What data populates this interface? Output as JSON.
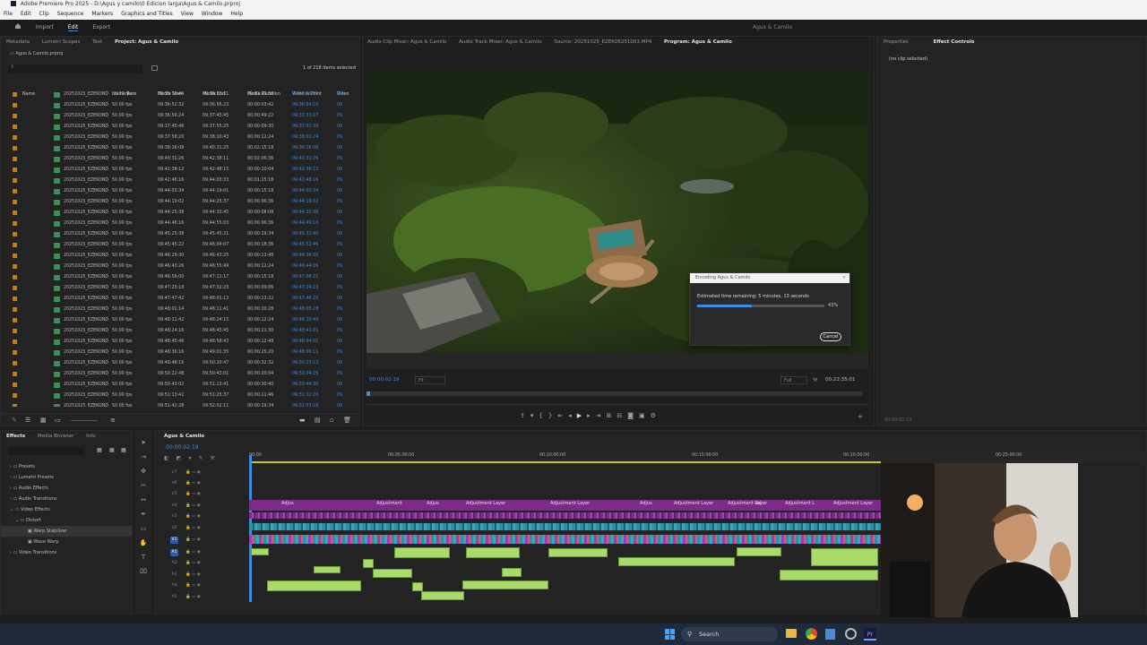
{
  "window": {
    "title": "Adobe Premiere Pro 2025 - D:\\Agus y camilo\\0 Edicion larga\\Agus & Camilo.prproj"
  },
  "menu": [
    "File",
    "Edit",
    "Clip",
    "Sequence",
    "Markers",
    "Graphics and Titles",
    "View",
    "Window",
    "Help"
  ],
  "workspace": {
    "tabs": [
      "Import",
      "Edit",
      "Export"
    ],
    "active": "Edit",
    "sequence_title": "Agus & Camilo"
  },
  "left_panel": {
    "tabs": [
      "Metadata",
      "Lumetri Scopes",
      "Text",
      "Project: Agus & Camilo"
    ],
    "project_file": "Agus & Camilo.prproj",
    "search_placeholder": "",
    "selection_info": "1 of 218 items selected",
    "columns": [
      "Name",
      "Frame Rate",
      "Media Start",
      "Media End",
      "Media Duration",
      "Video In Point",
      "Video"
    ],
    "rows": [
      [
        "20251025_EZEKOND",
        "50.00 fps",
        "09:35:10:44",
        "09:36:52:31",
        "00:01:43:38",
        "09:36:32:29",
        "09"
      ],
      [
        "20251025_EZEKOND",
        "50.00 fps",
        "09:36:52:32",
        "09:36:56:23",
        "00:00:03:42",
        "09:36:54:10",
        "09"
      ],
      [
        "20251025_EZEKOND",
        "50.00 fps",
        "09:36:56:24",
        "09:37:45:45",
        "00:00:49:22",
        "09:37:33:07",
        "09"
      ],
      [
        "20251025_EZEKOND",
        "50.00 fps",
        "09:37:45:46",
        "09:37:55:25",
        "00:00:09:30",
        "09:37:51:39",
        "09"
      ],
      [
        "20251025_EZEKOND",
        "50.00 fps",
        "09:37:58:20",
        "09:38:10:43",
        "00:00:12:24",
        "09:38:01:24",
        "09"
      ],
      [
        "20251025_EZEKOND",
        "50.00 fps",
        "09:38:16:08",
        "09:40:31:25",
        "00:02:15:18",
        "09:38:16:08",
        "09"
      ],
      [
        "20251025_EZEKOND",
        "50.00 fps",
        "09:40:31:26",
        "09:42:38:11",
        "00:02:06:36",
        "09:40:31:26",
        "09"
      ],
      [
        "20251025_EZEKOND",
        "50.00 fps",
        "09:42:38:12",
        "09:42:48:15",
        "00:00:10:04",
        "09:42:38:12",
        "09"
      ],
      [
        "20251025_EZEKOND",
        "50.00 fps",
        "09:42:48:16",
        "09:44:03:33",
        "00:01:15:18",
        "09:42:48:16",
        "09"
      ],
      [
        "20251025_EZEKOND",
        "50.00 fps",
        "09:44:03:34",
        "09:44:19:01",
        "00:00:15:18",
        "09:44:03:34",
        "09"
      ],
      [
        "20251025_EZEKOND",
        "50.00 fps",
        "09:44:19:02",
        "09:44:25:37",
        "00:00:06:36",
        "09:44:19:02",
        "09"
      ],
      [
        "20251025_EZEKOND",
        "50.00 fps",
        "09:44:25:38",
        "09:44:33:45",
        "00:00:08:08",
        "09:44:25:38",
        "09"
      ],
      [
        "20251025_EZEKOND",
        "50.00 fps",
        "09:44:48:16",
        "09:44:55:03",
        "00:00:06:36",
        "09:44:49:10",
        "09"
      ],
      [
        "20251025_EZEKOND",
        "50.00 fps",
        "09:45:25:38",
        "09:45:45:21",
        "00:00:19:34",
        "09:45:31:46",
        "09"
      ],
      [
        "20251025_EZEKOND",
        "50.00 fps",
        "09:45:45:22",
        "09:46:04:07",
        "00:00:18:36",
        "09:45:52:46",
        "09"
      ],
      [
        "20251025_EZEKOND",
        "50.00 fps",
        "09:46:29:30",
        "09:46:43:25",
        "00:00:13:46",
        "09:46:36:35",
        "09"
      ],
      [
        "20251025_EZEKOND",
        "50.00 fps",
        "09:46:43:26",
        "09:46:55:49",
        "00:00:12:24",
        "09:46:44:06",
        "09"
      ],
      [
        "20251025_EZEKOND",
        "50.00 fps",
        "09:46:56:00",
        "09:47:11:17",
        "00:00:15:18",
        "09:47:08:21",
        "09"
      ],
      [
        "20251025_EZEKOND",
        "50.00 fps",
        "09:47:23:18",
        "09:47:32:23",
        "00:00:09:06",
        "09:47:24:23",
        "09"
      ],
      [
        "20251025_EZEKOND",
        "50.00 fps",
        "09:47:47:42",
        "09:48:01:13",
        "00:00:13:22",
        "09:47:48:25",
        "09"
      ],
      [
        "20251025_EZEKOND",
        "50.00 fps",
        "09:48:01:14",
        "09:48:11:41",
        "00:00:10:28",
        "09:48:05:28",
        "09"
      ],
      [
        "20251025_EZEKOND",
        "50.00 fps",
        "09:48:11:42",
        "09:48:24:15",
        "00:00:12:24",
        "09:48:19:49",
        "09"
      ],
      [
        "20251025_EZEKOND",
        "50.00 fps",
        "09:48:24:16",
        "09:48:45:45",
        "00:00:21:30",
        "09:48:41:01",
        "09"
      ],
      [
        "20251025_EZEKOND",
        "50.00 fps",
        "09:48:45:46",
        "09:48:58:43",
        "00:00:12:48",
        "09:48:54:01",
        "09"
      ],
      [
        "20251025_EZEKOND",
        "50.00 fps",
        "09:48:36:16",
        "09:49:01:35",
        "00:00:25:20",
        "09:48:56:11",
        "09"
      ],
      [
        "20251025_EZEKOND",
        "50.00 fps",
        "09:49:48:16",
        "09:50:20:47",
        "00:00:32:32",
        "09:50:13:13",
        "09"
      ],
      [
        "20251025_EZEKOND",
        "50.00 fps",
        "09:50:22:48",
        "09:50:43:01",
        "00:00:20:04",
        "09:50:34:25",
        "09"
      ],
      [
        "20251025_EZEKOND",
        "50.00 fps",
        "09:50:43:02",
        "09:51:13:41",
        "00:00:30:40",
        "09:50:44:30",
        "09"
      ],
      [
        "20251025_EZEKOND",
        "50.00 fps",
        "09:51:13:42",
        "09:51:25:37",
        "00:00:11:46",
        "09:51:12:20",
        "09"
      ],
      [
        "20251025_EZEKOND",
        "50.00 fps",
        "09:51:42:28",
        "09:52:02:11",
        "00:00:19:34",
        "09:51:53:18",
        "09"
      ]
    ]
  },
  "monitor": {
    "source_tabs": [
      "Audio Clip Mixer: Agus & Camilo",
      "Audio Track Mixer: Agus & Camilo",
      "Source: 20251025_EZEK06251003.MP4",
      "Program: Agus & Camilo"
    ],
    "timecode_current": "00:00:02:19",
    "fit": "Fit",
    "quality": "Full",
    "timecode_total": "00:22:35:01"
  },
  "encoding_dialog": {
    "title": "Encoding Agus & Camilo",
    "message": "Estimated time remaining: 5 minutes, 13 seconds",
    "progress": 0.43,
    "progress_label": "43%",
    "cancel_label": "Cancel"
  },
  "right_panel": {
    "tabs": [
      "Properties",
      "Effect Controls"
    ],
    "no_clip": "(no clip selected)",
    "footer_timecode": "00:00:02:19"
  },
  "effects_panel": {
    "tabs": [
      "Effects",
      "Media Browser",
      "Info"
    ],
    "tree": [
      "Presets",
      "Lumetri Presets",
      "Audio Effects",
      "Audio Transitions",
      "Video Effects",
      "Distort",
      "Warp Stabilizer",
      "Wave Warp",
      "Video Transitions"
    ]
  },
  "timeline": {
    "sequence_tab": "Agus & Camilo",
    "timecode": "00:00:02:19",
    "ruler": [
      "00:00",
      "00:05:00:00",
      "00:10:00:00",
      "00:15:00:00",
      "00:20:00:00",
      "00:25:00:00"
    ],
    "tracks": [
      "V7",
      "V6",
      "V5",
      "V4",
      "V3",
      "V2",
      "V1",
      "A1",
      "A2",
      "A3",
      "A4",
      "A5"
    ],
    "adjustment_labels": [
      "Adjus",
      "Adjustment",
      "Adjus",
      "Adjustment Layer",
      "Adjustment Layer",
      "Adjus",
      "Adjustment Layer",
      "Adjustment Layer",
      "Ad",
      "Adjustment L",
      "Adjustment Layer"
    ]
  },
  "taskbar": {
    "search_label": "Search"
  },
  "colors": {
    "accent_blue": "#3e8cdc",
    "adjustment_purple": "#a23bb0",
    "audio_green": "#a7dc6a",
    "video_teal": "#2f8fa3"
  }
}
